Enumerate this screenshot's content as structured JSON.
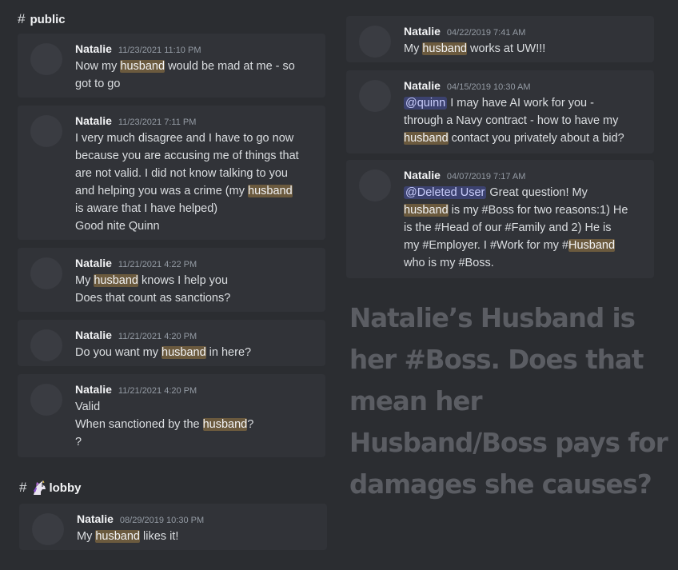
{
  "channels": {
    "public": {
      "hash": "#",
      "name": "public"
    },
    "lobby": {
      "hash": "#",
      "name": "lobby",
      "icon": "unicorn-icon"
    }
  },
  "left_messages": [
    {
      "author": "Natalie",
      "timestamp": "11/23/2021 11:10 PM",
      "lines": [
        {
          "pre": "Now my ",
          "hl": "husband",
          "post": " would be mad at me - so"
        },
        {
          "pre": "got to go",
          "hl": "",
          "post": ""
        }
      ]
    },
    {
      "author": "Natalie",
      "timestamp": "11/23/2021 7:11 PM",
      "lines": [
        {
          "pre": "I very much disagree and I have to go now",
          "hl": "",
          "post": ""
        },
        {
          "pre": "because you are accusing me of things that",
          "hl": "",
          "post": ""
        },
        {
          "pre": "are not valid. I did not know talking to you",
          "hl": "",
          "post": ""
        },
        {
          "pre": "and helping you was a crime (my ",
          "hl": "husband",
          "post": ""
        },
        {
          "pre": "is aware that I have helped)",
          "hl": "",
          "post": ""
        },
        {
          "pre": "Good nite Quinn",
          "hl": "",
          "post": ""
        }
      ]
    },
    {
      "author": "Natalie",
      "timestamp": "11/21/2021 4:22 PM",
      "lines": [
        {
          "pre": "My ",
          "hl": "husband",
          "post": " knows I help you"
        },
        {
          "pre": "Does that count as sanctions?",
          "hl": "",
          "post": ""
        }
      ]
    },
    {
      "author": "Natalie",
      "timestamp": "11/21/2021 4:20 PM",
      "lines": [
        {
          "pre": "Do you want my ",
          "hl": "husband",
          "post": " in here?"
        }
      ]
    },
    {
      "author": "Natalie",
      "timestamp": "11/21/2021 4:20 PM",
      "lines": [
        {
          "pre": "Valid",
          "hl": "",
          "post": ""
        },
        {
          "pre": "When sanctioned by the ",
          "hl": "husband",
          "post": "?"
        },
        {
          "pre": "?",
          "hl": "",
          "post": ""
        }
      ]
    }
  ],
  "lobby_message": {
    "author": "Natalie",
    "timestamp": "08/29/2019 10:30 PM",
    "lines": [
      {
        "pre": "My ",
        "hl": "husband",
        "post": " likes it!"
      }
    ]
  },
  "right_messages": [
    {
      "author": "Natalie",
      "timestamp": "04/22/2019 7:41 AM",
      "lines": [
        {
          "mention": "",
          "pre": "My ",
          "hl": "husband",
          "post": " works at UW!!!"
        }
      ]
    },
    {
      "author": "Natalie",
      "timestamp": "04/15/2019 10:30 AM",
      "lines": [
        {
          "mention": "@quinn",
          "pre": " I may have AI work for you -",
          "hl": "",
          "post": ""
        },
        {
          "mention": "",
          "pre": "through a Navy contract - how to have my",
          "hl": "",
          "post": ""
        },
        {
          "mention": "",
          "pre": "",
          "hl": "husband",
          "post": " contact you privately about a bid?"
        }
      ]
    },
    {
      "author": "Natalie",
      "timestamp": "04/07/2019 7:17 AM",
      "lines": [
        {
          "mention": "@Deleted User",
          "pre": " Great question!  My",
          "hl": "",
          "post": ""
        },
        {
          "mention": "",
          "pre": "",
          "hl": "husband",
          "post": " is my #Boss for two reasons:1) He"
        },
        {
          "mention": "",
          "pre": "is the #Head of our #Family and 2) He is",
          "hl": "",
          "post": ""
        },
        {
          "mention": "",
          "pre": "my #Employer.  I #Work for my  #",
          "hl": "Husband",
          "post": ""
        },
        {
          "mention": "",
          "pre": "who is my #Boss.",
          "hl": "",
          "post": ""
        }
      ]
    }
  ],
  "overlay_text": [
    "Natalie’s Husband is",
    "her #Boss. Does that",
    "mean her",
    "Husband/Boss pays for",
    "damages she causes?"
  ],
  "colors": {
    "background": "#2b2d31",
    "message_bg": "#313338",
    "highlight": "#6b5a3e",
    "mention": "#3c4270",
    "overlay_text": "#5b5d63"
  }
}
